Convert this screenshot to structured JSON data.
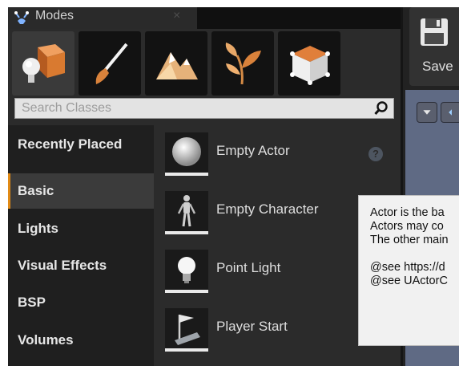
{
  "panel": {
    "title": "Modes",
    "close": "×"
  },
  "mode_buttons": [
    {
      "name": "place-mode",
      "icon": "place-icon"
    },
    {
      "name": "paint-mode",
      "icon": "paintbrush-icon"
    },
    {
      "name": "landscape-mode",
      "icon": "mountain-icon"
    },
    {
      "name": "foliage-mode",
      "icon": "leaf-icon"
    },
    {
      "name": "geometry-mode",
      "icon": "cube-edit-icon"
    }
  ],
  "search": {
    "placeholder": "Search Classes"
  },
  "categories": [
    {
      "label": "Recently Placed",
      "selected": false
    },
    {
      "label": "Basic",
      "selected": true
    },
    {
      "label": "Lights",
      "selected": false
    },
    {
      "label": "Visual Effects",
      "selected": false
    },
    {
      "label": "BSP",
      "selected": false
    },
    {
      "label": "Volumes",
      "selected": false
    }
  ],
  "items": [
    {
      "label": "Empty Actor",
      "icon": "sphere-icon"
    },
    {
      "label": "Empty Character",
      "icon": "character-icon"
    },
    {
      "label": "Point Light",
      "icon": "lightbulb-icon"
    },
    {
      "label": "Player Start",
      "icon": "flag-icon"
    }
  ],
  "toolbar": {
    "save_label": "Save"
  },
  "tooltip": {
    "lines": [
      "Actor is the ba",
      "Actors may co",
      "The other main",
      "",
      "@see https://d",
      "@see UActorC"
    ]
  },
  "colors": {
    "accent": "#e18a15",
    "panel": "#2b2b2b",
    "viewport": "#5f6a84"
  }
}
